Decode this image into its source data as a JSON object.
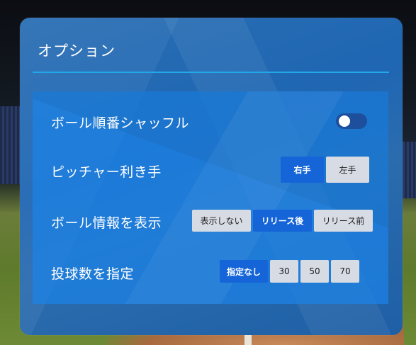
{
  "panel": {
    "title": "オプション"
  },
  "options": {
    "shuffle": {
      "label": "ボール順番シャッフル",
      "enabled": false
    },
    "handedness": {
      "label": "ピッチャー利き手",
      "buttons": [
        "右手",
        "左手"
      ],
      "selected": "右手"
    },
    "ball_info": {
      "label": "ボール情報を表示",
      "buttons": [
        "表示しない",
        "リリース後",
        "リリース前"
      ],
      "selected": "リリース後"
    },
    "pitch_count": {
      "label": "投球数を指定",
      "buttons": [
        "指定なし",
        "30",
        "50",
        "70"
      ],
      "selected": "指定なし"
    }
  },
  "colors": {
    "accent": "#1565d8",
    "rule": "#22a7e8",
    "unselected": "#d6dbe4"
  }
}
